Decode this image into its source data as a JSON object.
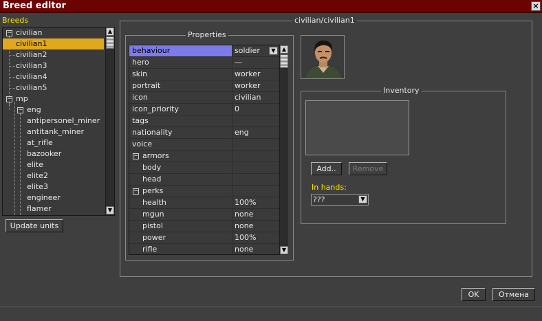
{
  "window": {
    "title": "Breed editor",
    "close_glyph": "×"
  },
  "breeds": {
    "label": "Breeds",
    "tree": [
      {
        "label": "civilian",
        "level": 0,
        "expander": "−"
      },
      {
        "label": "civilian1",
        "level": 1,
        "selected": true
      },
      {
        "label": "civilian2",
        "level": 1
      },
      {
        "label": "civilian3",
        "level": 1
      },
      {
        "label": "civilian4",
        "level": 1
      },
      {
        "label": "civilian5",
        "level": 1
      },
      {
        "label": "mp",
        "level": 0,
        "expander": "−"
      },
      {
        "label": "eng",
        "level": 1,
        "expander": "−"
      },
      {
        "label": "antipersonel_miner",
        "level": 2
      },
      {
        "label": "antitank_miner",
        "level": 2
      },
      {
        "label": "at_rifle",
        "level": 2
      },
      {
        "label": "bazooker",
        "level": 2
      },
      {
        "label": "elite",
        "level": 2
      },
      {
        "label": "elite2",
        "level": 2
      },
      {
        "label": "elite3",
        "level": 2
      },
      {
        "label": "engineer",
        "level": 2
      },
      {
        "label": "flamer",
        "level": 2
      }
    ],
    "update_button": "Update units"
  },
  "panel": {
    "title": "civilian/civilian1",
    "properties_title": "Properties",
    "properties": [
      {
        "name": "behaviour",
        "value": "soldier",
        "selected": true,
        "combo": true
      },
      {
        "name": "hero",
        "value": "—"
      },
      {
        "name": "skin",
        "value": "worker"
      },
      {
        "name": "portrait",
        "value": "worker"
      },
      {
        "name": "icon",
        "value": "civilian"
      },
      {
        "name": "icon_priority",
        "value": "0"
      },
      {
        "name": "tags",
        "value": ""
      },
      {
        "name": "nationality",
        "value": "eng"
      },
      {
        "name": "voice",
        "value": ""
      },
      {
        "name": "armors",
        "value": "",
        "group": true,
        "expander": "−"
      },
      {
        "name": "body",
        "value": "",
        "child": true
      },
      {
        "name": "head",
        "value": "",
        "child": true
      },
      {
        "name": "perks",
        "value": "",
        "group": true,
        "expander": "−"
      },
      {
        "name": "health",
        "value": "100%",
        "child": true
      },
      {
        "name": "mgun",
        "value": "none",
        "child": true
      },
      {
        "name": "pistol",
        "value": "none",
        "child": true
      },
      {
        "name": "power",
        "value": "100%",
        "child": true
      },
      {
        "name": "rifle",
        "value": "none",
        "child": true
      }
    ],
    "inventory_title": "Inventory",
    "add_button": "Add..",
    "remove_button": "Remove",
    "in_hands_label": "In hands:",
    "in_hands_value": "???"
  },
  "footer": {
    "ok_button": "OK",
    "cancel_button": "Отмена"
  },
  "colors": {
    "titlebar": "#6b0303",
    "selection_tree": "#e0a81c",
    "selection_property": "#7c7ce8",
    "label_accent": "#ffe800"
  },
  "icons": {
    "scroll_up": "▲",
    "scroll_down": "▼",
    "combo_arrow": "▼"
  }
}
